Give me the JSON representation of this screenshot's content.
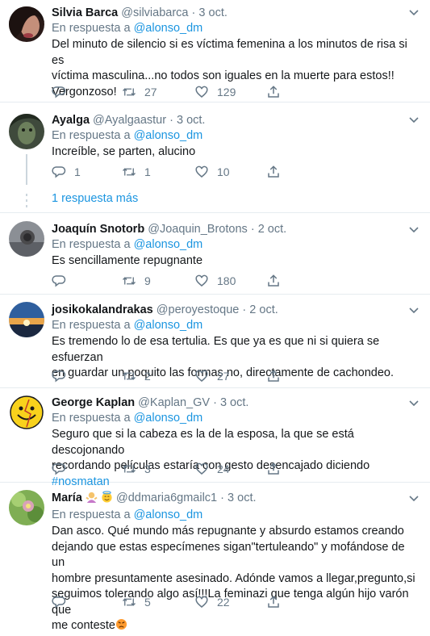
{
  "tweets": [
    {
      "name": "Silvia Barca",
      "handle": "@silviabarca",
      "date": "3 oct.",
      "reply_prefix": "En respuesta a",
      "reply_to": "@alonso_dm",
      "lines": [
        "Del minuto de silencio si es víctima femenina a los minutos de risa si es",
        "víctima masculina...no todos son iguales en la muerte para estos!!",
        "Vergonzoso!"
      ],
      "replies": "",
      "retweets": "27",
      "likes": "129"
    },
    {
      "name": "Ayalga",
      "handle": "@Ayalgaastur",
      "date": "3 oct.",
      "reply_prefix": "En respuesta a",
      "reply_to": "@alonso_dm",
      "lines": [
        "Increíble, se parten, alucino"
      ],
      "replies": "1",
      "retweets": "1",
      "likes": "10"
    },
    {
      "name": "Joaquín Snotorb",
      "handle": "@Joaquin_Brotons",
      "date": "2 oct.",
      "reply_prefix": "En respuesta a",
      "reply_to": "@alonso_dm",
      "lines": [
        "Es sencillamente repugnante"
      ],
      "replies": "",
      "retweets": "9",
      "likes": "180"
    },
    {
      "name": "josikokalandrakas",
      "handle": "@peroyestoque",
      "date": "2 oct.",
      "reply_prefix": "En respuesta a",
      "reply_to": "@alonso_dm",
      "lines": [
        "Es tremendo lo de esa tertulia. Es que ya es que ni si quiera se esfuerzan",
        "en guardar un poquito las formas no, directamente de cachondeo."
      ],
      "replies": "",
      "retweets": "2",
      "likes": "27"
    },
    {
      "name": "George Kaplan",
      "handle": "@Kaplan_GV",
      "date": "3 oct.",
      "reply_prefix": "En respuesta a",
      "reply_to": "@alonso_dm",
      "lines": [
        "Seguro que si la cabeza es la de la esposa, la que se está descojonando",
        "recordando películas estaría con gesto desencajado diciendo "
      ],
      "hashtag": "#nosmatan",
      "replies": "",
      "retweets": "3",
      "likes": "24"
    },
    {
      "name": "María",
      "handle": "@ddmaria6gmailc1",
      "date": "3 oct.",
      "reply_prefix": "En respuesta a",
      "reply_to": "@alonso_dm",
      "lines": [
        "Dan asco. Qué mundo más repugnante y absurdo estamos creando",
        "dejando que estas especímenes sigan\"tertuleando\" y mofándose de un",
        "hombre presuntamente asesinado. Adónde vamos a llegar,pregunto,si",
        "seguimos tolerando algo así!!!La feminazi que tenga algún hijo varón que",
        "me conteste"
      ],
      "replies": "",
      "retweets": "5",
      "likes": "22"
    }
  ],
  "show_more": "1 respuesta más",
  "icons": {
    "reply": "reply-icon",
    "retweet": "retweet-icon",
    "like": "heart-icon",
    "share": "share-icon",
    "caret": "chevron-down-icon"
  },
  "colors": {
    "link": "#1b95e0",
    "muted": "#657786",
    "divider": "#e6ecf0"
  }
}
